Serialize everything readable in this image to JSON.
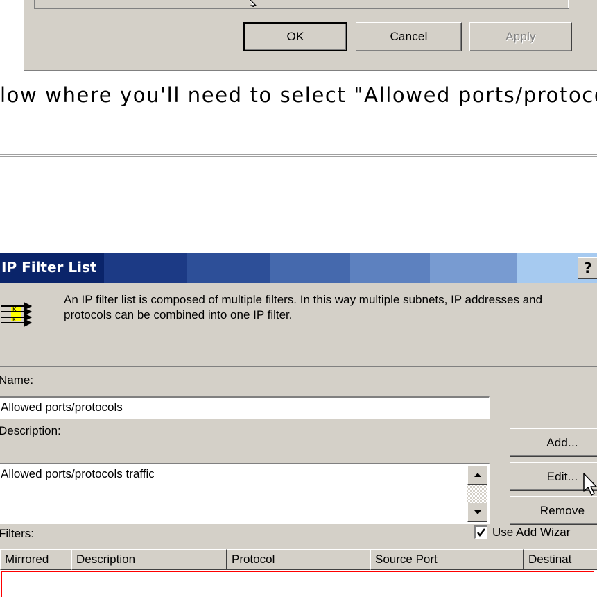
{
  "top_dialog": {
    "buttons": {
      "ok": "OK",
      "cancel": "Cancel",
      "apply": "Apply"
    }
  },
  "article": {
    "text": "low where you'll need to select \"Allowed ports/protoco"
  },
  "dialog": {
    "title": "IP Filter List",
    "help_label": "?",
    "header_description": "An IP filter list is composed of multiple filters. In this way multiple subnets, IP addresses and protocols can be combined into one IP filter.",
    "name_label": "Name:",
    "name_value": "Allowed ports/protocols",
    "description_label": "Description:",
    "description_value": "Allowed ports/protocols traffic",
    "buttons": {
      "add": "Add...",
      "edit": "Edit...",
      "remove": "Remove"
    },
    "use_add_wizard": {
      "label": "Use Add Wizar",
      "checked": true
    },
    "filters_label": "Filters:",
    "columns": [
      "Mirrored",
      "Description",
      "Protocol",
      "Source Port",
      "Destinat"
    ]
  }
}
